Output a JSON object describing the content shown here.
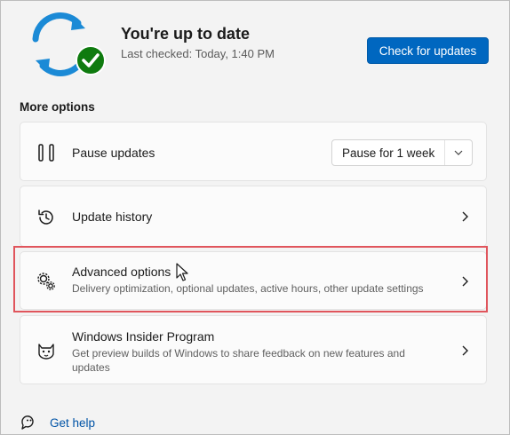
{
  "status": {
    "title": "You're up to date",
    "last_checked": "Last checked: Today, 1:40 PM",
    "icon": "sync-icon",
    "badge_icon": "checkmark-icon"
  },
  "check_button": {
    "label": "Check for updates"
  },
  "more_options": {
    "title": "More options",
    "items": [
      {
        "icon": "pause-icon",
        "title": "Pause updates",
        "control": {
          "type": "select",
          "value": "Pause for 1 week"
        }
      },
      {
        "icon": "history-icon",
        "title": "Update history"
      },
      {
        "icon": "gears-icon",
        "title": "Advanced options",
        "description": "Delivery optimization, optional updates, active hours, other update settings"
      },
      {
        "icon": "insider-cat-icon",
        "title": "Windows Insider Program",
        "description": "Get preview builds of Windows to share feedback on new features and updates"
      }
    ]
  },
  "help": {
    "label": "Get help",
    "icon": "help-icon"
  },
  "colors": {
    "accent": "#0067c0",
    "highlight": "#e0555c",
    "success": "#0f7b0f"
  }
}
